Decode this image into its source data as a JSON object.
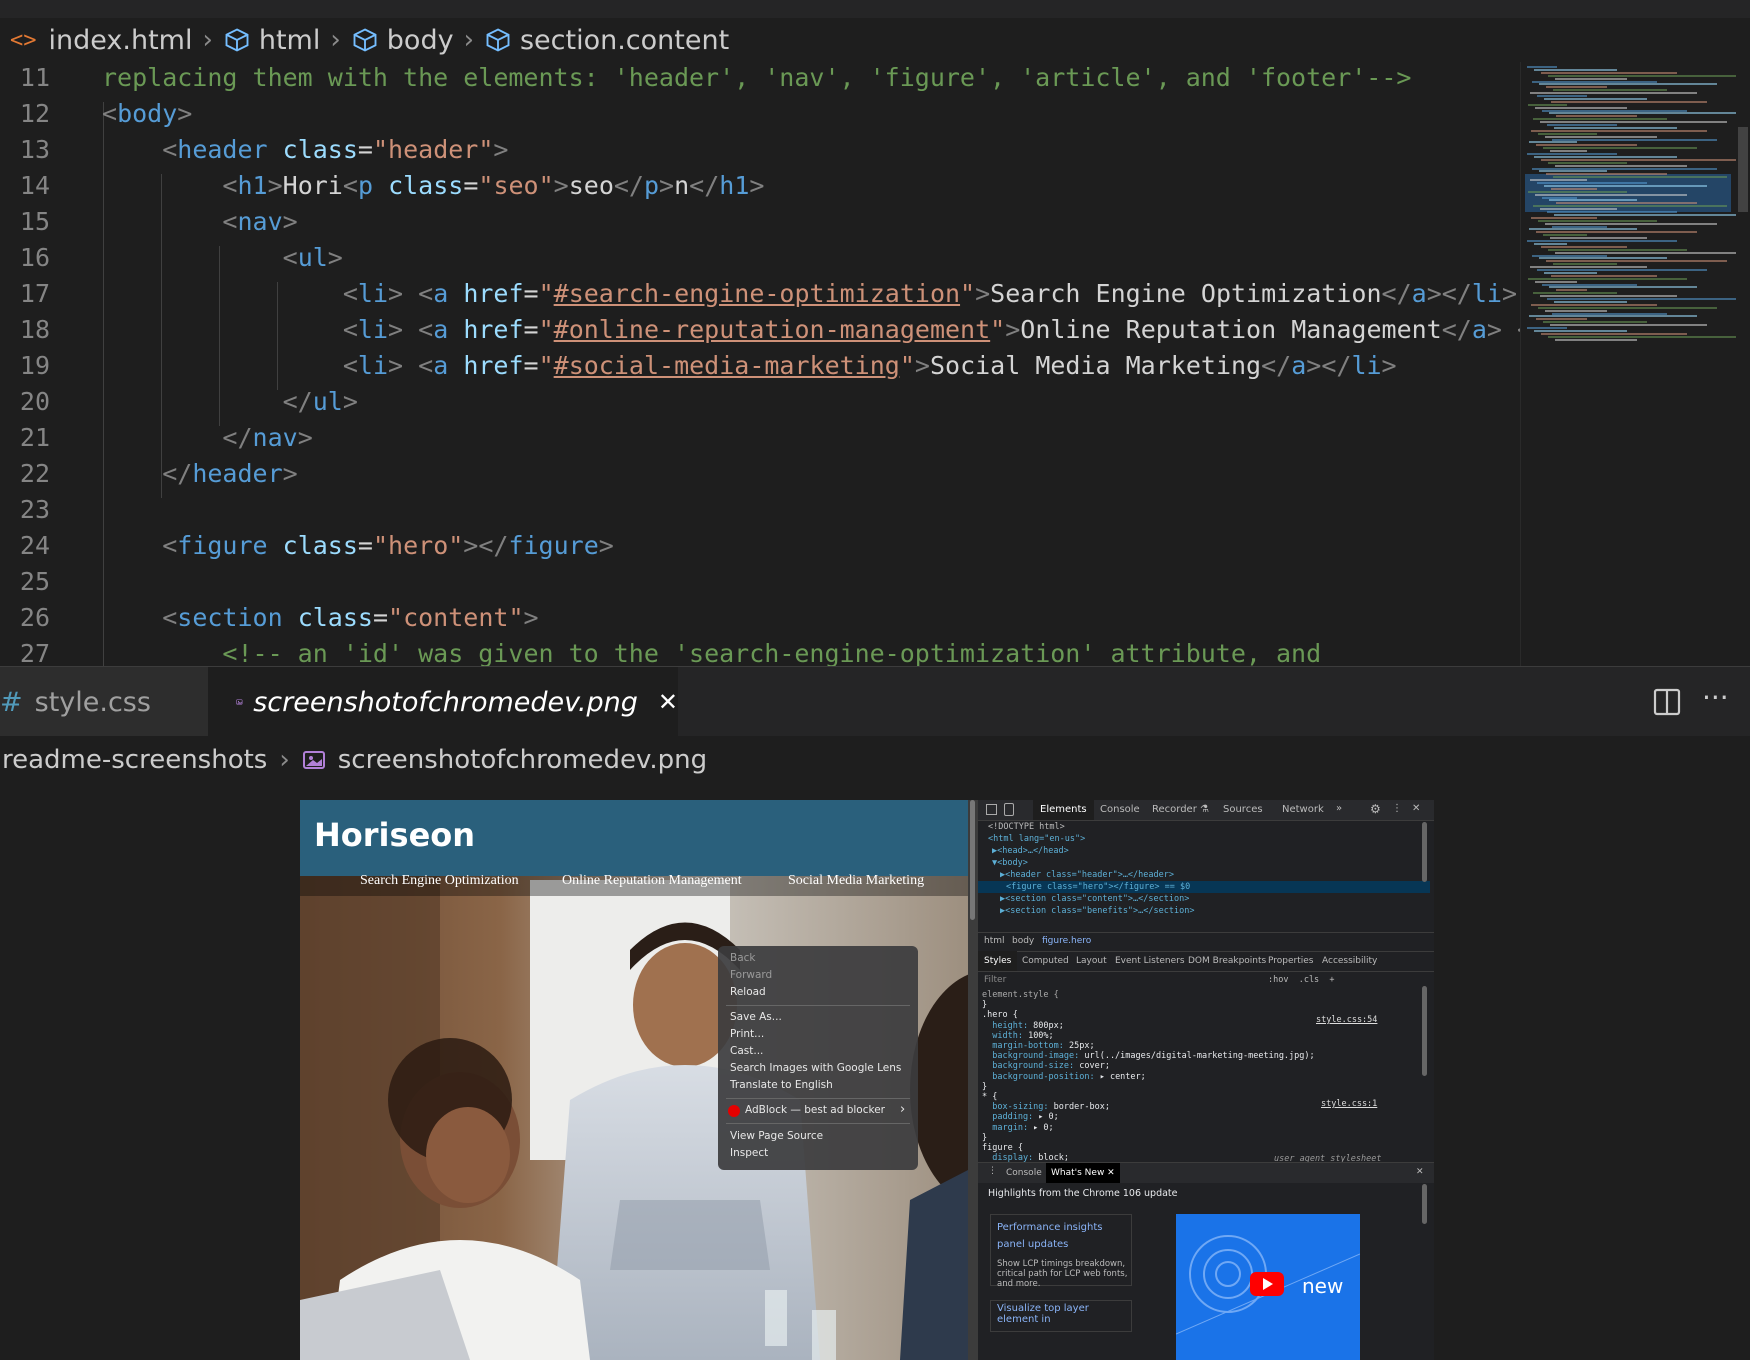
{
  "breadcrumb": {
    "file": "index.html",
    "items": [
      "html",
      "body",
      "section.content"
    ]
  },
  "code_lines": [
    {
      "n": "11",
      "parts": [
        {
          "c": "cm",
          "t": "replacing them with the elements: 'header', 'nav', 'figure', 'article', and 'footer'-->"
        }
      ]
    },
    {
      "n": "12",
      "parts": [
        {
          "c": "t",
          "t": "<"
        },
        {
          "c": "tn",
          "t": "body"
        },
        {
          "c": "t",
          "t": ">"
        }
      ]
    },
    {
      "n": "13",
      "parts": [
        {
          "c": "sp",
          "t": "    "
        },
        {
          "c": "t",
          "t": "<"
        },
        {
          "c": "tn",
          "t": "header"
        },
        {
          "c": "tx",
          "t": " "
        },
        {
          "c": "an",
          "t": "class"
        },
        {
          "c": "tx",
          "t": "="
        },
        {
          "c": "av",
          "t": "\"header\""
        },
        {
          "c": "t",
          "t": ">"
        }
      ]
    },
    {
      "n": "14",
      "parts": [
        {
          "c": "sp",
          "t": "        "
        },
        {
          "c": "t",
          "t": "<"
        },
        {
          "c": "tn",
          "t": "h1"
        },
        {
          "c": "t",
          "t": ">"
        },
        {
          "c": "tx",
          "t": "Hori"
        },
        {
          "c": "t",
          "t": "<"
        },
        {
          "c": "tn",
          "t": "p"
        },
        {
          "c": "tx",
          "t": " "
        },
        {
          "c": "an",
          "t": "class"
        },
        {
          "c": "tx",
          "t": "="
        },
        {
          "c": "av",
          "t": "\"seo\""
        },
        {
          "c": "t",
          "t": ">"
        },
        {
          "c": "tx",
          "t": "seo"
        },
        {
          "c": "t",
          "t": "</"
        },
        {
          "c": "tn",
          "t": "p"
        },
        {
          "c": "t",
          "t": ">"
        },
        {
          "c": "tx",
          "t": "n"
        },
        {
          "c": "t",
          "t": "</"
        },
        {
          "c": "tn",
          "t": "h1"
        },
        {
          "c": "t",
          "t": ">"
        }
      ]
    },
    {
      "n": "15",
      "parts": [
        {
          "c": "sp",
          "t": "        "
        },
        {
          "c": "t",
          "t": "<"
        },
        {
          "c": "tn",
          "t": "nav"
        },
        {
          "c": "t",
          "t": ">"
        }
      ]
    },
    {
      "n": "16",
      "parts": [
        {
          "c": "sp",
          "t": "            "
        },
        {
          "c": "t",
          "t": "<"
        },
        {
          "c": "tn",
          "t": "ul"
        },
        {
          "c": "t",
          "t": ">"
        }
      ]
    },
    {
      "n": "17",
      "parts": [
        {
          "c": "sp",
          "t": "                "
        },
        {
          "c": "t",
          "t": "<"
        },
        {
          "c": "tn",
          "t": "li"
        },
        {
          "c": "t",
          "t": ">"
        },
        {
          "c": "tx",
          "t": " "
        },
        {
          "c": "t",
          "t": "<"
        },
        {
          "c": "tn",
          "t": "a"
        },
        {
          "c": "tx",
          "t": " "
        },
        {
          "c": "an",
          "t": "href"
        },
        {
          "c": "tx",
          "t": "="
        },
        {
          "c": "av",
          "t": "\""
        },
        {
          "c": "lk",
          "t": "#search-engine-optimization"
        },
        {
          "c": "av",
          "t": "\""
        },
        {
          "c": "t",
          "t": ">"
        },
        {
          "c": "tx",
          "t": "Search Engine Optimization"
        },
        {
          "c": "t",
          "t": "</"
        },
        {
          "c": "tn",
          "t": "a"
        },
        {
          "c": "t",
          "t": "></"
        },
        {
          "c": "tn",
          "t": "li"
        },
        {
          "c": "t",
          "t": ">"
        }
      ]
    },
    {
      "n": "18",
      "parts": [
        {
          "c": "sp",
          "t": "                "
        },
        {
          "c": "t",
          "t": "<"
        },
        {
          "c": "tn",
          "t": "li"
        },
        {
          "c": "t",
          "t": ">"
        },
        {
          "c": "tx",
          "t": " "
        },
        {
          "c": "t",
          "t": "<"
        },
        {
          "c": "tn",
          "t": "a"
        },
        {
          "c": "tx",
          "t": " "
        },
        {
          "c": "an",
          "t": "href"
        },
        {
          "c": "tx",
          "t": "="
        },
        {
          "c": "av",
          "t": "\""
        },
        {
          "c": "lk",
          "t": "#online-reputation-management"
        },
        {
          "c": "av",
          "t": "\""
        },
        {
          "c": "t",
          "t": ">"
        },
        {
          "c": "tx",
          "t": "Online Reputation Management"
        },
        {
          "c": "t",
          "t": "</"
        },
        {
          "c": "tn",
          "t": "a"
        },
        {
          "c": "t",
          "t": ">"
        },
        {
          "c": "tx",
          "t": " "
        },
        {
          "c": "t",
          "t": "</"
        },
        {
          "c": "tn",
          "t": "li"
        }
      ]
    },
    {
      "n": "19",
      "parts": [
        {
          "c": "sp",
          "t": "                "
        },
        {
          "c": "t",
          "t": "<"
        },
        {
          "c": "tn",
          "t": "li"
        },
        {
          "c": "t",
          "t": ">"
        },
        {
          "c": "tx",
          "t": " "
        },
        {
          "c": "t",
          "t": "<"
        },
        {
          "c": "tn",
          "t": "a"
        },
        {
          "c": "tx",
          "t": " "
        },
        {
          "c": "an",
          "t": "href"
        },
        {
          "c": "tx",
          "t": "="
        },
        {
          "c": "av",
          "t": "\""
        },
        {
          "c": "lk",
          "t": "#social-media-marketing"
        },
        {
          "c": "av",
          "t": "\""
        },
        {
          "c": "t",
          "t": ">"
        },
        {
          "c": "tx",
          "t": "Social Media Marketing"
        },
        {
          "c": "t",
          "t": "</"
        },
        {
          "c": "tn",
          "t": "a"
        },
        {
          "c": "t",
          "t": "></"
        },
        {
          "c": "tn",
          "t": "li"
        },
        {
          "c": "t",
          "t": ">"
        }
      ]
    },
    {
      "n": "20",
      "parts": [
        {
          "c": "sp",
          "t": "            "
        },
        {
          "c": "t",
          "t": "</"
        },
        {
          "c": "tn",
          "t": "ul"
        },
        {
          "c": "t",
          "t": ">"
        }
      ]
    },
    {
      "n": "21",
      "parts": [
        {
          "c": "sp",
          "t": "        "
        },
        {
          "c": "t",
          "t": "</"
        },
        {
          "c": "tn",
          "t": "nav"
        },
        {
          "c": "t",
          "t": ">"
        }
      ]
    },
    {
      "n": "22",
      "parts": [
        {
          "c": "sp",
          "t": "    "
        },
        {
          "c": "t",
          "t": "</"
        },
        {
          "c": "tn",
          "t": "header"
        },
        {
          "c": "t",
          "t": ">"
        }
      ]
    },
    {
      "n": "23",
      "parts": []
    },
    {
      "n": "24",
      "parts": [
        {
          "c": "sp",
          "t": "    "
        },
        {
          "c": "t",
          "t": "<"
        },
        {
          "c": "tn",
          "t": "figure"
        },
        {
          "c": "tx",
          "t": " "
        },
        {
          "c": "an",
          "t": "class"
        },
        {
          "c": "tx",
          "t": "="
        },
        {
          "c": "av",
          "t": "\"hero\""
        },
        {
          "c": "t",
          "t": "></"
        },
        {
          "c": "tn",
          "t": "figure"
        },
        {
          "c": "t",
          "t": ">"
        }
      ]
    },
    {
      "n": "25",
      "parts": []
    },
    {
      "n": "26",
      "parts": [
        {
          "c": "sp",
          "t": "    "
        },
        {
          "c": "t",
          "t": "<"
        },
        {
          "c": "tn",
          "t": "section"
        },
        {
          "c": "tx",
          "t": " "
        },
        {
          "c": "an",
          "t": "class"
        },
        {
          "c": "tx",
          "t": "="
        },
        {
          "c": "av",
          "t": "\"content\""
        },
        {
          "c": "t",
          "t": ">"
        }
      ]
    },
    {
      "n": "27",
      "parts": [
        {
          "c": "sp",
          "t": "        "
        },
        {
          "c": "cm",
          "t": "<!-- an 'id' was given to the 'search-engine-optimization' attribute, and"
        }
      ]
    }
  ],
  "tabs": [
    {
      "icon": "#",
      "label": "style.css"
    },
    {
      "label": "screenshotofchromedev.png",
      "close": "✕"
    }
  ],
  "editor_actions": {
    "split": "split-editor",
    "more": "···"
  },
  "image_breadcrumb": {
    "folder": "readme-screenshots",
    "file": "screenshotofchromedev.png"
  },
  "site": {
    "title": "Horiseon",
    "nav": [
      "Search Engine Optimization",
      "Online Reputation Management",
      "Social Media Marketing"
    ]
  },
  "context_menu": {
    "items": [
      "Back",
      "Forward",
      "Reload",
      "Save As...",
      "Print...",
      "Cast...",
      "Search Images with Google Lens",
      "Translate to English",
      "AdBlock — best ad blocker",
      "View Page Source",
      "Inspect"
    ],
    "submenu_arrow": "›"
  },
  "devtools": {
    "top_tabs": [
      "Elements",
      "Console",
      "Recorder ⚗",
      "Sources",
      "Network",
      "»"
    ],
    "dom": [
      "<!DOCTYPE html>",
      "<html lang=\"en-us\">",
      "▶<head>…</head>",
      "▼<body>",
      "▶<header class=\"header\">…</header>",
      "<figure class=\"hero\"></figure> == $0",
      "▶<section class=\"content\">…</section>",
      "▶<section class=\"benefits\">…</section>"
    ],
    "dom_crumbs": [
      "html",
      "body",
      "figure.hero"
    ],
    "style_tabs": [
      "Styles",
      "Computed",
      "Layout",
      "Event Listeners",
      "DOM Breakpoints",
      "Properties",
      "Accessibility"
    ],
    "filter_placeholder": "Filter",
    "filter_tools": ":hov  .cls  +",
    "styles": [
      "element.style {",
      "}",
      ".hero {",
      "  height: 800px;",
      "  width: 100%;",
      "  margin-bottom: 25px;",
      "  background-image: url(../images/digital-marketing-meeting.jpg);",
      "  background-size: cover;",
      "  background-position: ▸ center;",
      "}",
      "* {",
      "  box-sizing: border-box;",
      "  padding: ▸ 0;",
      "  margin: ▸ 0;",
      "}",
      "figure {",
      "  display: block;"
    ],
    "style_sources": [
      "style.css:54",
      "style.css:1",
      "user agent stylesheet"
    ],
    "drawer_tabs": [
      "Console",
      "What's New ✕"
    ],
    "drawer_heading": "Highlights from the Chrome 106 update",
    "card_title": "Performance insights panel updates",
    "card_text": "Show LCP timings breakdown, critical path for LCP web fonts, and more.",
    "card2_title": "Visualize top layer element in",
    "video_label": "new"
  }
}
